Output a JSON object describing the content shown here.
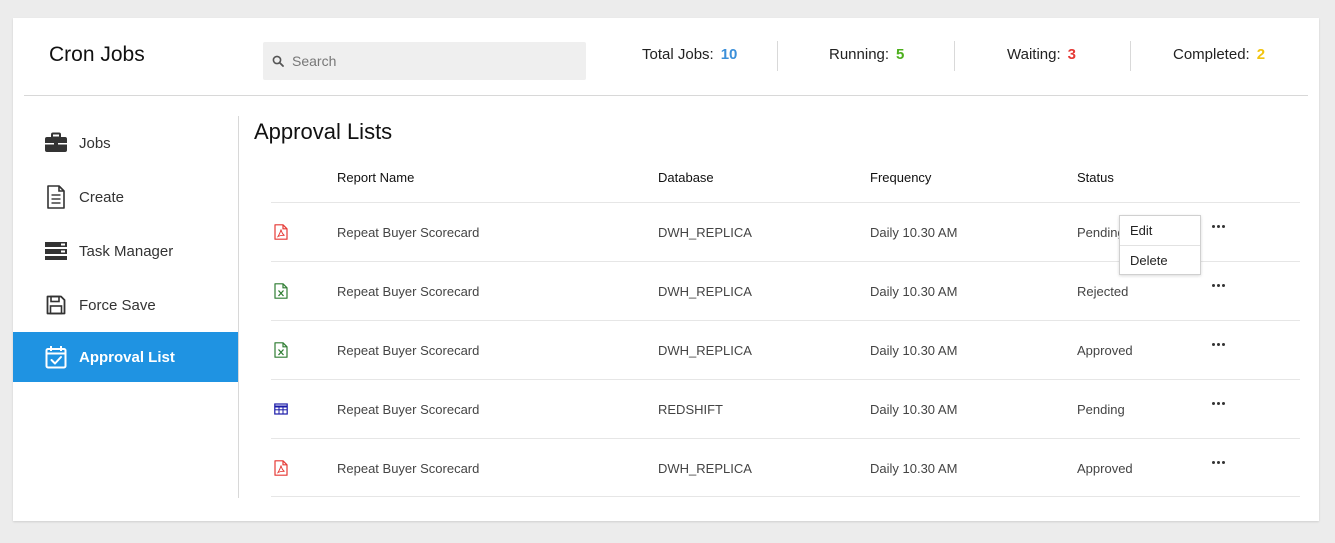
{
  "app": {
    "title": "Cron Jobs"
  },
  "search": {
    "placeholder": "Search"
  },
  "stats": [
    {
      "label": "Total Jobs:",
      "value": "10",
      "color": "#3b8fd9"
    },
    {
      "label": "Running:",
      "value": "5",
      "color": "#4caf1c"
    },
    {
      "label": "Waiting:",
      "value": "3",
      "color": "#e53935"
    },
    {
      "label": "Completed:",
      "value": "2",
      "color": "#f2c40f"
    }
  ],
  "sidebar": {
    "items": [
      {
        "label": "Jobs",
        "icon": "briefcase-icon"
      },
      {
        "label": "Create",
        "icon": "document-icon"
      },
      {
        "label": "Task Manager",
        "icon": "task-list-icon"
      },
      {
        "label": "Force Save",
        "icon": "floppy-disk-icon"
      },
      {
        "label": "Approval List",
        "icon": "calendar-check-icon",
        "active": true
      }
    ]
  },
  "main": {
    "title": "Approval Lists",
    "columns": [
      "Report Name",
      "Database",
      "Frequency",
      "Status"
    ],
    "rows": [
      {
        "file_icon": "pdf-icon",
        "report": "Repeat Buyer Scorecard",
        "database": "DWH_REPLICA",
        "frequency": "Daily 10.30 AM",
        "status": "Pending"
      },
      {
        "file_icon": "excel-icon",
        "report": "Repeat Buyer Scorecard",
        "database": "DWH_REPLICA",
        "frequency": "Daily 10.30 AM",
        "status": "Rejected"
      },
      {
        "file_icon": "excel-icon",
        "report": "Repeat Buyer Scorecard",
        "database": "DWH_REPLICA",
        "frequency": "Daily 10.30 AM",
        "status": "Approved"
      },
      {
        "file_icon": "table-icon",
        "report": "Repeat Buyer Scorecard",
        "database": "REDSHIFT",
        "frequency": "Daily 10.30 AM",
        "status": "Pending"
      },
      {
        "file_icon": "pdf-icon",
        "report": "Repeat Buyer Scorecard",
        "database": "DWH_REPLICA",
        "frequency": "Daily 10.30 AM",
        "status": "Approved"
      }
    ]
  },
  "context_menu": {
    "items": [
      "Edit",
      "Delete"
    ]
  }
}
